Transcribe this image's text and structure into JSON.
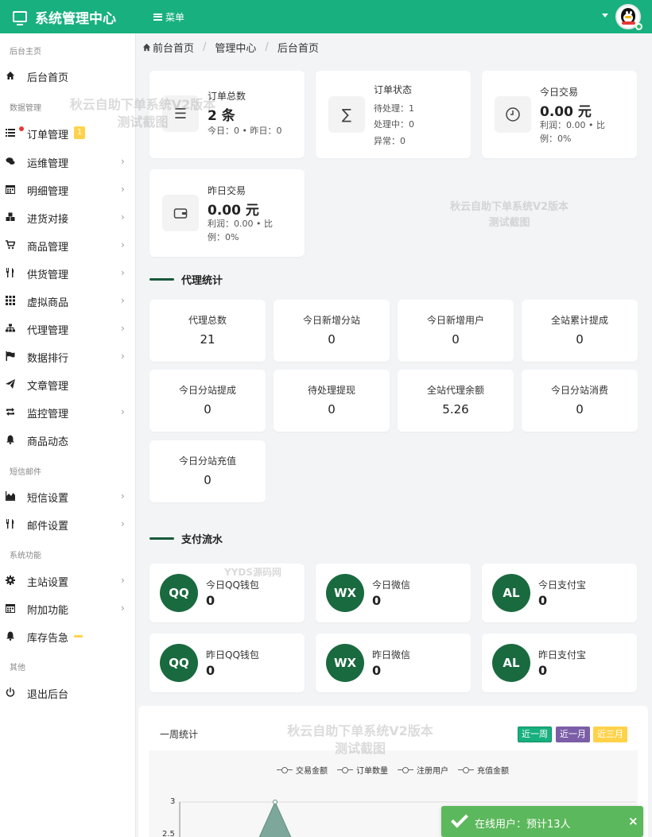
{
  "header": {
    "title": "系统管理中心",
    "menu_label": "菜单"
  },
  "sidebar": {
    "groups": [
      "后台主页",
      "数据管理",
      "短信邮件",
      "系统功能",
      "其他"
    ],
    "items": [
      {
        "label": "后台首页",
        "icon": "home-icon"
      },
      {
        "label": "订单管理",
        "icon": "list-icon",
        "badge": "1"
      },
      {
        "label": "运维管理",
        "icon": "comments-icon"
      },
      {
        "label": "明细管理",
        "icon": "calendar-icon"
      },
      {
        "label": "进货对接",
        "icon": "cubes-icon"
      },
      {
        "label": "商品管理",
        "icon": "cart-icon"
      },
      {
        "label": "供货管理",
        "icon": "utensils-icon"
      },
      {
        "label": "虚拟商品",
        "icon": "grid-icon"
      },
      {
        "label": "代理管理",
        "icon": "sitemap-icon"
      },
      {
        "label": "数据排行",
        "icon": "flag-icon"
      },
      {
        "label": "文章管理",
        "icon": "send-icon"
      },
      {
        "label": "监控管理",
        "icon": "retweet-icon"
      },
      {
        "label": "商品动态",
        "icon": "bell-icon"
      },
      {
        "label": "短信设置",
        "icon": "area-chart-icon"
      },
      {
        "label": "邮件设置",
        "icon": "utensils-icon"
      },
      {
        "label": "主站设置",
        "icon": "gear-icon"
      },
      {
        "label": "附加功能",
        "icon": "calendar-icon"
      },
      {
        "label": "库存告急",
        "icon": "bell-icon"
      },
      {
        "label": "退出后台",
        "icon": "power-icon"
      }
    ]
  },
  "breadcrumb": [
    "前台首页",
    "管理中心",
    "后台首页"
  ],
  "stats": [
    {
      "title": "订单总数",
      "value": "2 条",
      "sub": [
        "今日：0 • 昨日：0"
      ],
      "icon": "list-icon"
    },
    {
      "title": "订单状态",
      "value": "",
      "sub": [
        "待处理：1",
        "处理中：0",
        "异常：0"
      ],
      "icon": "sigma-icon"
    },
    {
      "title": "今日交易",
      "value": "0.00 元",
      "sub": [
        "利润：0.00 • 比",
        "例：0%"
      ],
      "icon": "clock-icon"
    },
    {
      "title": "昨日交易",
      "value": "0.00 元",
      "sub": [
        "利润：0.00 • 比",
        "例：0%"
      ],
      "icon": "wallet-icon"
    }
  ],
  "agent_section": {
    "title": "代理统计",
    "cards": [
      {
        "label": "代理总数",
        "value": "21"
      },
      {
        "label": "今日新增分站",
        "value": "0"
      },
      {
        "label": "今日新增用户",
        "value": "0"
      },
      {
        "label": "全站累计提成",
        "value": "0"
      },
      {
        "label": "今日分站提成",
        "value": "0"
      },
      {
        "label": "待处理提现",
        "value": "0"
      },
      {
        "label": "全站代理余额",
        "value": "5.26"
      },
      {
        "label": "今日分站消费",
        "value": "0"
      },
      {
        "label": "今日分站充值",
        "value": "0"
      }
    ]
  },
  "pay_section": {
    "title": "支付流水",
    "cards": [
      {
        "abbr": "QQ",
        "label": "今日QQ钱包",
        "value": "0"
      },
      {
        "abbr": "WX",
        "label": "今日微信",
        "value": "0"
      },
      {
        "abbr": "AL",
        "label": "今日支付宝",
        "value": "0"
      },
      {
        "abbr": "QQ",
        "label": "昨日QQ钱包",
        "value": "0"
      },
      {
        "abbr": "WX",
        "label": "昨日微信",
        "value": "0"
      },
      {
        "abbr": "AL",
        "label": "昨日支付宝",
        "value": "0"
      }
    ]
  },
  "chart": {
    "title": "一周统计",
    "ranges": [
      {
        "label": "近一周",
        "color": "#17b07e"
      },
      {
        "label": "近一月",
        "color": "#7b5ea7"
      },
      {
        "label": "近三月",
        "color": "#ffd24a"
      }
    ],
    "legend": [
      "交易金额",
      "订单数量",
      "注册用户",
      "充值金额"
    ],
    "y_ticks": [
      "3",
      "2.5"
    ]
  },
  "watermarks": [
    {
      "line1": "秋云自助下单系统V2版本",
      "line2": "测试截图"
    },
    {
      "line1": "秋云自助下单系统V2版本",
      "line2": "测试截图"
    },
    {
      "line1": "YYDS源码网",
      "line2": ""
    },
    {
      "line1": "秋云自助下单系统V2版本",
      "line2": "测试截图"
    }
  ],
  "toast": {
    "text": "在线用户：预计13人",
    "close": "×"
  },
  "colors": {
    "primary": "#17b07e",
    "pay_circle": "#1a6a3f",
    "badge": "#ffd24a",
    "toast": "#5cb85c"
  }
}
